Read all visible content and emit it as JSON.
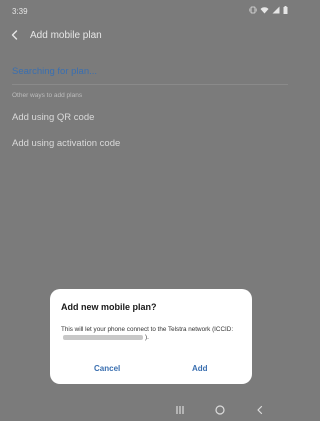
{
  "status_bar": {
    "time": "3:39",
    "icons": [
      "vibrate-icon",
      "wifi-icon",
      "signal-icon",
      "battery-icon"
    ]
  },
  "header": {
    "title": "Add mobile plan",
    "back_icon": "back-arrow-icon"
  },
  "main": {
    "searching_label": "Searching for plan...",
    "section_label": "Other ways to add plans",
    "options": [
      "Add using QR code",
      "Add using activation code"
    ]
  },
  "dialog": {
    "title": "Add new mobile plan?",
    "body_prefix": "This will let your phone connect to the Telstra network (ICCID:",
    "body_suffix": ").",
    "cancel_label": "Cancel",
    "add_label": "Add"
  },
  "nav_bar": {
    "buttons": [
      "recents-icon",
      "home-icon",
      "back-icon"
    ]
  },
  "colors": {
    "accent": "#3a6fb0",
    "dim_background": "#7b7b7b",
    "dialog_background": "#ffffff"
  }
}
